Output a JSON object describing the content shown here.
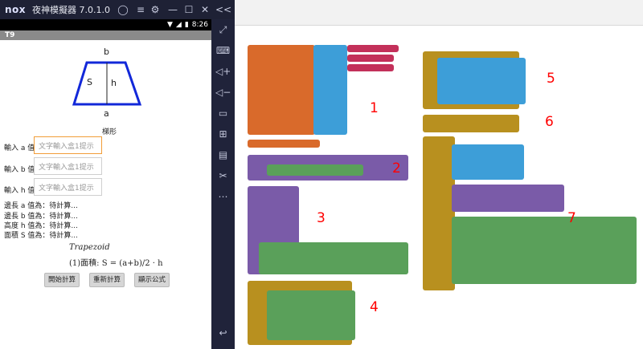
{
  "emulator": {
    "logo": "nox",
    "title": "夜神模擬器 7.0.1.0",
    "statusbar_time": "8:26",
    "app_name": "T9",
    "side_collapse": "<<"
  },
  "phone": {
    "label_b": "b",
    "label_s": "S",
    "label_h": "h",
    "label_a": "a",
    "shape_caption": "梯形",
    "input_a_label": "輸入 a 值 :",
    "input_b_label": "輸入 b 值 :",
    "input_h_label": "輸入 h 值 :",
    "input_placeholder": "文字輸入盒1提示",
    "result_a": "邊長 a 值為：待計算...",
    "result_b": "邊長 b 值為：待計算...",
    "result_h": "高度 h 值為：待計算...",
    "result_s": "面積 S 值為：待計算...",
    "formula_title": "Trapezoid",
    "formula_text": "(1)面積: S = (a+b)/2 · h",
    "btn_start": "開始計算",
    "btn_reset": "重新計算",
    "btn_show": "顯示公式"
  },
  "annotations": [
    "1",
    "2",
    "3",
    "4",
    "5",
    "6",
    "7"
  ],
  "colors": {
    "orange_block": "#d96a2b",
    "blue_block": "#3d9ed8",
    "purple_block": "#7a5ba8",
    "brown_block": "#b8901f",
    "green_block": "#5aa05a",
    "pink_block": "#c3305a",
    "annotation_red": "#ff0000"
  }
}
